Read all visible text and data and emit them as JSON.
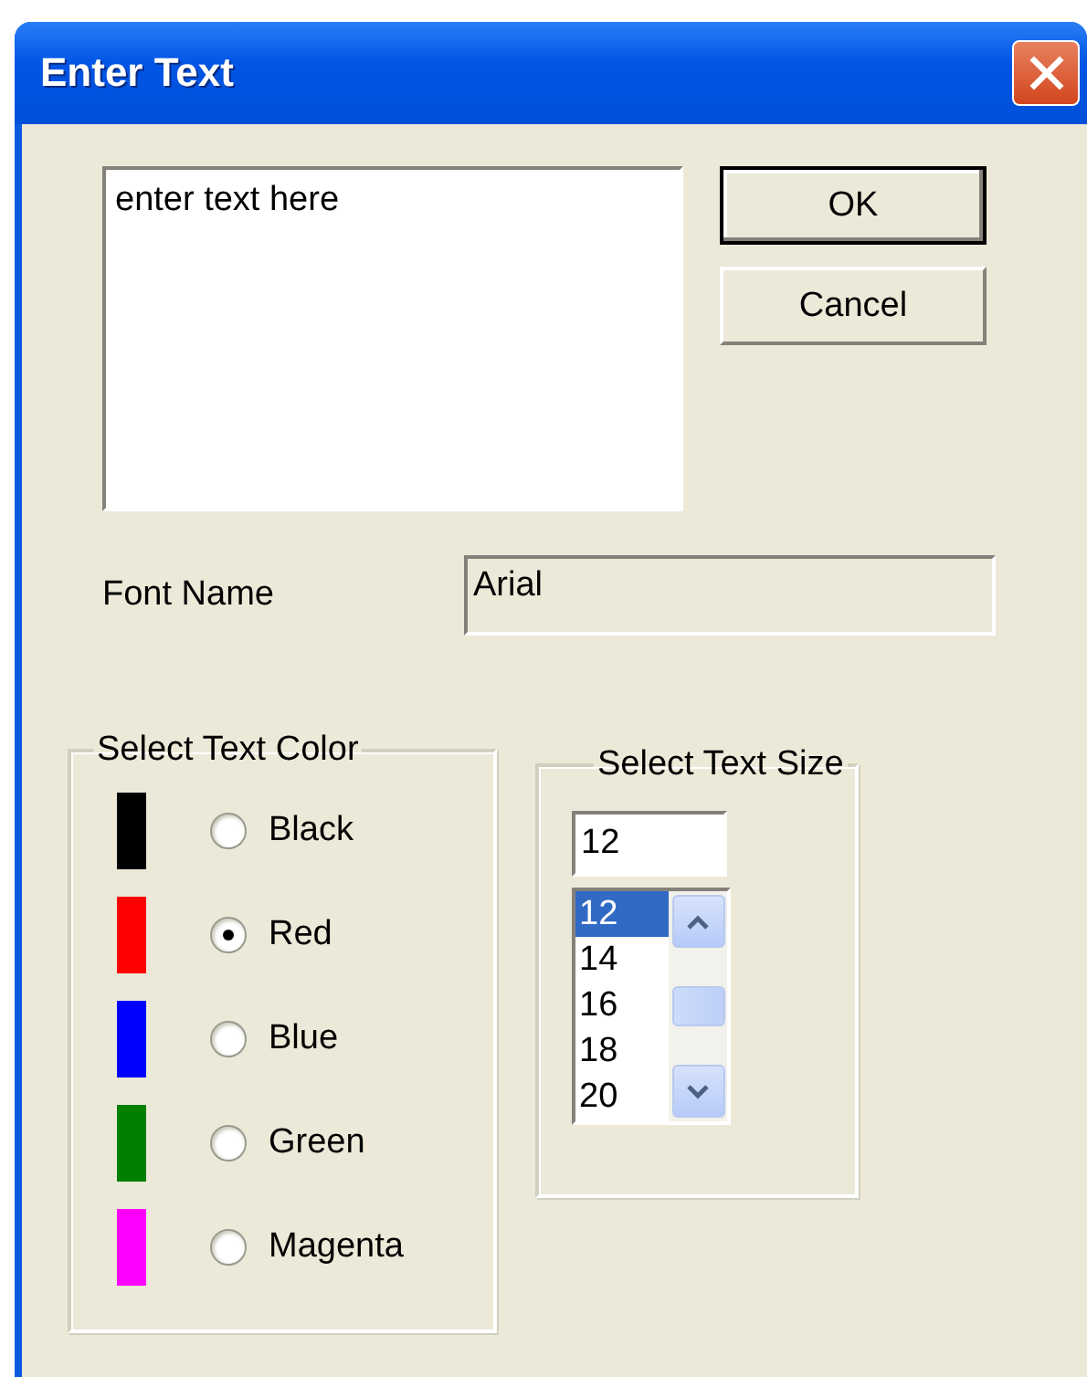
{
  "window": {
    "title": "Enter Text"
  },
  "text_area": {
    "value": "enter text here"
  },
  "buttons": [
    {
      "label": "OK",
      "default": true
    },
    {
      "label": "Cancel",
      "default": false
    }
  ],
  "font_name": {
    "label": "Font Name",
    "value": "Arial"
  },
  "color_group": {
    "title": "Select Text Color",
    "options": [
      {
        "label": "Black",
        "color": "#000000",
        "selected": false
      },
      {
        "label": "Red",
        "color": "#ff0000",
        "selected": true
      },
      {
        "label": "Blue",
        "color": "#0000ff",
        "selected": false
      },
      {
        "label": "Green",
        "color": "#008000",
        "selected": false
      },
      {
        "label": "Magenta",
        "color": "#ff00ff",
        "selected": false
      }
    ]
  },
  "size_group": {
    "title": "Select Text Size",
    "input": {
      "value": "12"
    },
    "list": [
      {
        "label": "12",
        "selected": true
      },
      {
        "label": "14",
        "selected": false
      },
      {
        "label": "16",
        "selected": false
      },
      {
        "label": "18",
        "selected": false
      },
      {
        "label": "20",
        "selected": false
      }
    ]
  }
}
